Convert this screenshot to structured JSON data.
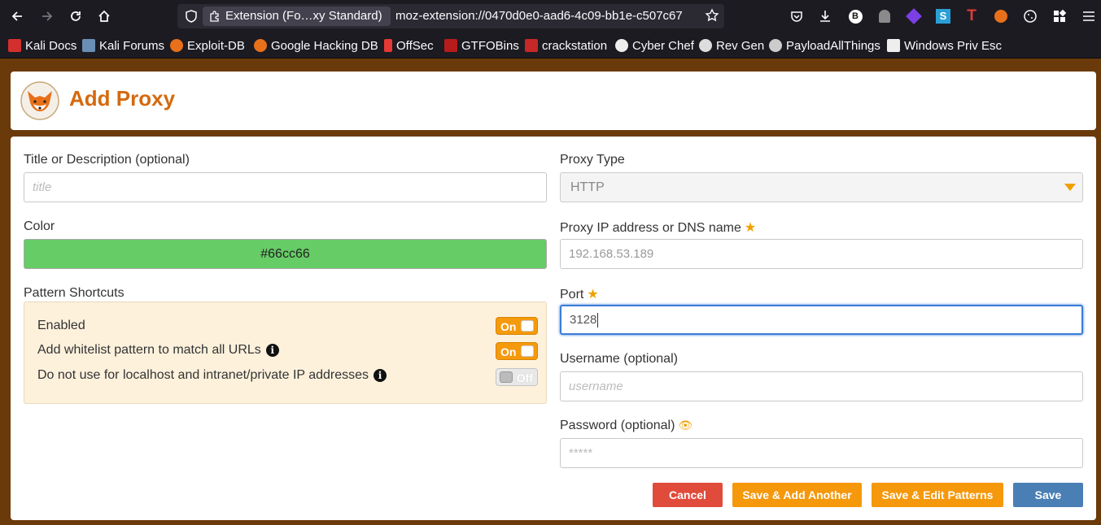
{
  "browser": {
    "tab_title": "Extension (Fo…xy Standard)",
    "url": "moz-extension://0470d0e0-aad6-4c09-bb1e-c507c67",
    "bookmarks": [
      {
        "label": "Kali Docs",
        "color": "#d32f2f"
      },
      {
        "label": "Kali Forums",
        "color": "#6a8fb5"
      },
      {
        "label": "Exploit-DB",
        "color": "#e8701a"
      },
      {
        "label": "Google Hacking DB",
        "color": "#e8701a"
      },
      {
        "label": "OffSec",
        "color": "#e53935"
      },
      {
        "label": "GTFOBins",
        "color": "#b71c1c"
      },
      {
        "label": "crackstation",
        "color": "#c62828"
      },
      {
        "label": "Cyber Chef",
        "color": "#eeeeee"
      },
      {
        "label": "Rev Gen",
        "color": "#dddddd"
      },
      {
        "label": "PayloadAllThings",
        "color": "#cccccc"
      },
      {
        "label": "Windows Priv Esc",
        "color": "#eeeeee"
      }
    ]
  },
  "header": {
    "title": "Add Proxy"
  },
  "form": {
    "title_label": "Title or Description (optional)",
    "title_placeholder": "title",
    "color_label": "Color",
    "color_value": "#66cc66",
    "pattern_label": "Pattern Shortcuts",
    "shortcuts": [
      {
        "label": "Enabled",
        "state": "On",
        "has_info": false
      },
      {
        "label": "Add whitelist pattern to match all URLs",
        "state": "On",
        "has_info": true
      },
      {
        "label": "Do not use for localhost and intranet/private IP addresses",
        "state": "Off",
        "has_info": true
      }
    ],
    "proxy_type_label": "Proxy Type",
    "proxy_type_value": "HTTP",
    "ip_label": "Proxy IP address or DNS name",
    "ip_value": "192.168.53.189",
    "port_label": "Port",
    "port_value": "3128",
    "username_label": "Username (optional)",
    "username_placeholder": "username",
    "password_label": "Password (optional)",
    "password_placeholder": "*****"
  },
  "buttons": {
    "cancel": "Cancel",
    "save_add": "Save & Add Another",
    "save_edit": "Save & Edit Patterns",
    "save": "Save"
  }
}
